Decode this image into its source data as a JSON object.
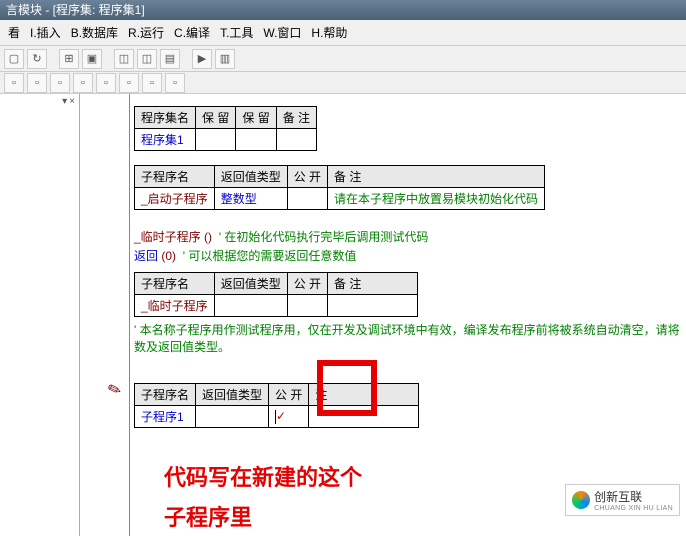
{
  "title": "言模块 - [程序集: 程序集1]",
  "menu": {
    "view": "看",
    "insert": "I.插入",
    "database": "B.数据库",
    "run": "R.运行",
    "compile": "C.编译",
    "tool": "T.工具",
    "window": "W.窗口",
    "help": "H.帮助"
  },
  "table1": {
    "h1": "程序集名",
    "h2": "保 留",
    "h3": "保 留",
    "h4": "备 注",
    "r1c1": "程序集1"
  },
  "table2": {
    "h1": "子程序名",
    "h2": "返回值类型",
    "h3": "公 开",
    "h4": "备  注",
    "r1c1": "_启动子程序",
    "r1c2": "整数型",
    "r1c4": "请在本子程序中放置易模块初始化代码"
  },
  "codeline1": {
    "a": "_临时子程序",
    "b": "()",
    "c": "'  在初始化代码执行完毕后调用测试代码"
  },
  "codeline2": {
    "a": "返回",
    "b": "(0)",
    "c": "'  可以根据您的需要返回任意数值"
  },
  "table3": {
    "h1": "子程序名",
    "h2": "返回值类型",
    "h3": "公 开",
    "h4": "备  注",
    "r1c1": "_临时子程序"
  },
  "comment": "'   本名称子程序用作测试程序用，仅在开发及调试环境中有效，编译发布程序前将被系统自动清空，请将数及返回值类型。",
  "table4": {
    "h1": "子程序名",
    "h2": "返回值类型",
    "h3": "公 开",
    "h4": "注",
    "r1c1": "子程序1",
    "r1c3": "✓"
  },
  "annotation": {
    "l1": "代码写在新建的这个",
    "l2": "子程序里"
  },
  "watermark": {
    "brand": "创新互联",
    "domain": "CHUANG XIN HU LIAN"
  }
}
